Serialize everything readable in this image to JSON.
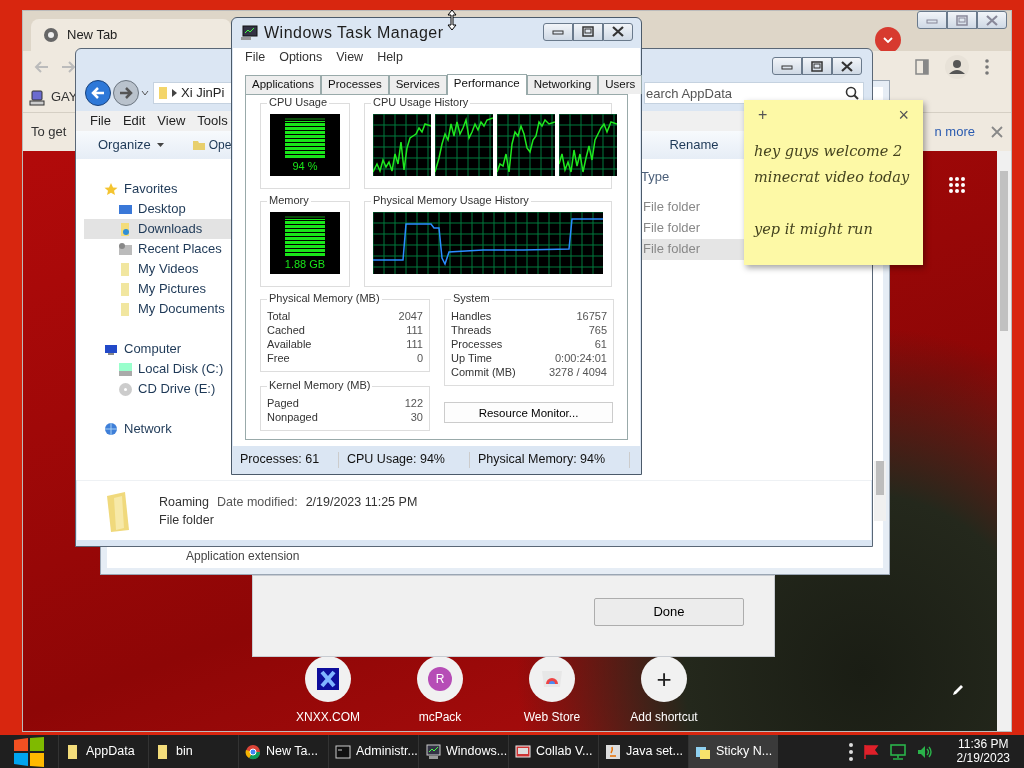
{
  "browser": {
    "tab": "New Tab",
    "bookmark": "GAY",
    "infobar_text": "To get",
    "infobar_link": "n more",
    "shortcuts": [
      {
        "kind": "x-logo",
        "label": "XNXX.COM"
      },
      {
        "kind": "letter",
        "letter": "R",
        "color": "#b64db6",
        "label": "mcPack"
      },
      {
        "kind": "store",
        "label": "Web Store"
      },
      {
        "kind": "add",
        "symbol": "+",
        "label": "Add shortcut"
      }
    ]
  },
  "installer": {
    "text": "Application extension",
    "button": "Done"
  },
  "explorer": {
    "breadcrumb": "Xi JinPi",
    "search_placeholder": "earch AppData",
    "menu": [
      "File",
      "Edit",
      "View",
      "Tools"
    ],
    "organize": "Organize",
    "open": "Ope",
    "rename": "Rename",
    "nav": [
      {
        "label": "Favorites",
        "kind": "star",
        "selected": false,
        "children": [
          {
            "label": "Desktop",
            "kind": "desktop",
            "selected": false
          },
          {
            "label": "Downloads",
            "kind": "download",
            "selected": true
          },
          {
            "label": "Recent Places",
            "kind": "recent",
            "selected": false
          },
          {
            "label": "My Videos",
            "kind": "folder",
            "selected": false
          },
          {
            "label": "My Pictures",
            "kind": "folder",
            "selected": false
          },
          {
            "label": "My Documents",
            "kind": "folder",
            "selected": false
          }
        ]
      },
      {
        "label": "Computer",
        "kind": "computer",
        "selected": false,
        "children": [
          {
            "label": "Local Disk (C:)",
            "kind": "disk",
            "selected": false
          },
          {
            "label": "CD Drive (E:)",
            "kind": "cd",
            "selected": false
          }
        ]
      },
      {
        "label": "Network",
        "kind": "network",
        "selected": false
      }
    ],
    "column": "Type",
    "rows": [
      {
        "type": "File folder",
        "selected": false
      },
      {
        "type": "File folder",
        "selected": false
      },
      {
        "type": "File folder",
        "selected": true
      }
    ],
    "details": {
      "name": "Roaming",
      "date_label": "Date modified:",
      "date": "2/19/2023 11:25 PM",
      "type": "File folder"
    }
  },
  "task_manager": {
    "title": "Windows Task Manager",
    "menu": [
      "File",
      "Options",
      "View",
      "Help"
    ],
    "tabs": [
      {
        "label": "Applications",
        "selected": false
      },
      {
        "label": "Processes",
        "selected": false
      },
      {
        "label": "Services",
        "selected": false
      },
      {
        "label": "Performance",
        "selected": true
      },
      {
        "label": "Networking",
        "selected": false
      },
      {
        "label": "Users",
        "selected": false
      }
    ],
    "cpu": {
      "label": "CPU Usage",
      "reading": "94 %",
      "level": 0.94
    },
    "cpu_history": {
      "label": "CPU Usage History"
    },
    "memory": {
      "label": "Memory",
      "reading": "1.88 GB",
      "level": 0.94
    },
    "memory_history": {
      "label": "Physical Memory Usage History"
    },
    "physical_memory": {
      "label": "Physical Memory (MB)",
      "rows": [
        {
          "name": "Total",
          "value": "2047"
        },
        {
          "name": "Cached",
          "value": "111"
        },
        {
          "name": "Available",
          "value": "111"
        },
        {
          "name": "Free",
          "value": "0"
        }
      ]
    },
    "kernel_memory": {
      "label": "Kernel Memory (MB)",
      "rows": [
        {
          "name": "Paged",
          "value": "122"
        },
        {
          "name": "Nonpaged",
          "value": "30"
        }
      ]
    },
    "system": {
      "label": "System",
      "rows": [
        {
          "name": "Handles",
          "value": "16757"
        },
        {
          "name": "Threads",
          "value": "765"
        },
        {
          "name": "Processes",
          "value": "61"
        },
        {
          "name": "Up Time",
          "value": "0:00:24:01"
        },
        {
          "name": "Commit (MB)",
          "value": "3278 / 4094"
        }
      ]
    },
    "resource_button": "Resource Monitor...",
    "status": [
      "Processes: 61",
      "CPU Usage: 94%",
      "Physical Memory: 94%"
    ]
  },
  "sticky_note": {
    "add": "+",
    "close": "×",
    "paragraphs": [
      "hey guys welcome 2 minecrat video today",
      "yep it might run"
    ]
  },
  "taskbar": {
    "items": [
      {
        "label": "AppData",
        "kind": "folder",
        "selected": false
      },
      {
        "label": "bin",
        "kind": "folder",
        "selected": false
      },
      {
        "label": "New Ta...",
        "kind": "browser",
        "selected": false
      },
      {
        "label": "Administr...",
        "kind": "console",
        "selected": false
      },
      {
        "label": "Windows...",
        "kind": "monitor",
        "selected": false
      },
      {
        "label": "Collab V...",
        "kind": "collab",
        "selected": false
      },
      {
        "label": "Java set...",
        "kind": "java",
        "selected": false
      },
      {
        "label": "Sticky N...",
        "kind": "notes",
        "selected": true
      }
    ],
    "time": "11:36 PM",
    "date": "2/19/2023"
  }
}
